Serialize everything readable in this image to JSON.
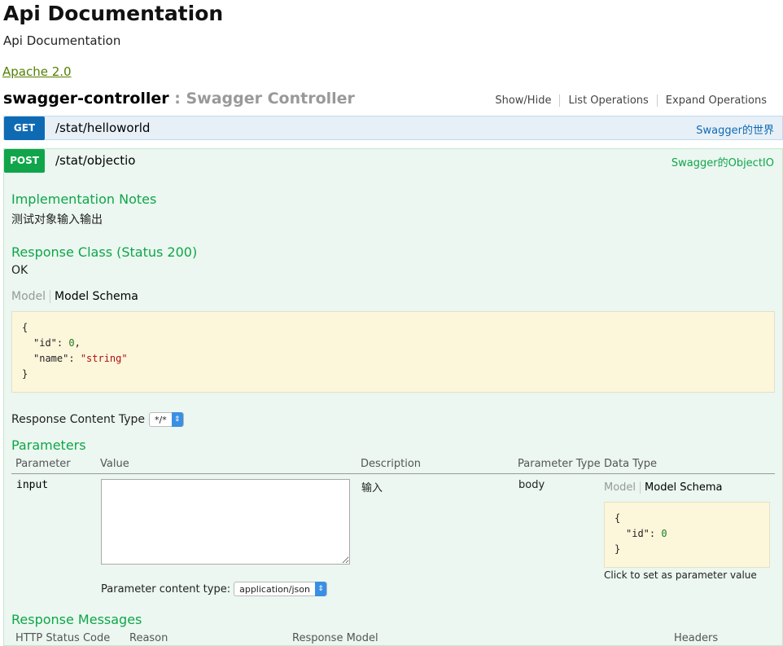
{
  "header": {
    "title": "Api Documentation",
    "subtitle": "Api Documentation",
    "license": "Apache 2.0"
  },
  "resource": {
    "name": "swagger-controller",
    "desc": " : Swagger Controller",
    "actions": [
      "Show/Hide",
      "List Operations",
      "Expand Operations"
    ]
  },
  "operations": [
    {
      "method": "GET",
      "path": "/stat/helloworld",
      "summary": "Swagger的世界"
    },
    {
      "method": "POST",
      "path": "/stat/objectio",
      "summary": "Swagger的ObjectIO"
    }
  ],
  "post_detail": {
    "impl_notes_title": "Implementation Notes",
    "impl_notes": "测试对象输入输出",
    "response_class_title": "Response Class (Status 200)",
    "response_class": "OK",
    "tab_model": "Model",
    "tab_schema": "Model Schema",
    "schema_open": "{",
    "schema_id_key": "\"id\"",
    "schema_id_val": "0",
    "schema_name_key": "\"name\"",
    "schema_name_val": "\"string\"",
    "schema_close": "}",
    "response_content_type_label": "Response Content Type",
    "response_content_type_value": "*/*",
    "parameters_title": "Parameters",
    "param_headers": [
      "Parameter",
      "Value",
      "Description",
      "Parameter Type",
      "Data Type"
    ],
    "param": {
      "name": "input",
      "value": "",
      "description": "输入",
      "type": "body"
    },
    "param_schema_id_key": "\"id\"",
    "param_schema_id_val": "0",
    "click_to_set": "Click to set as parameter value",
    "param_content_type_label": "Parameter content type:",
    "param_content_type_value": "application/json",
    "response_messages_title": "Response Messages",
    "response_headers": [
      "HTTP Status Code",
      "Reason",
      "Response Model",
      "Headers"
    ]
  },
  "colors": {
    "get": "#0f6ab4",
    "post": "#10a54a",
    "license_link": "#547f00"
  }
}
